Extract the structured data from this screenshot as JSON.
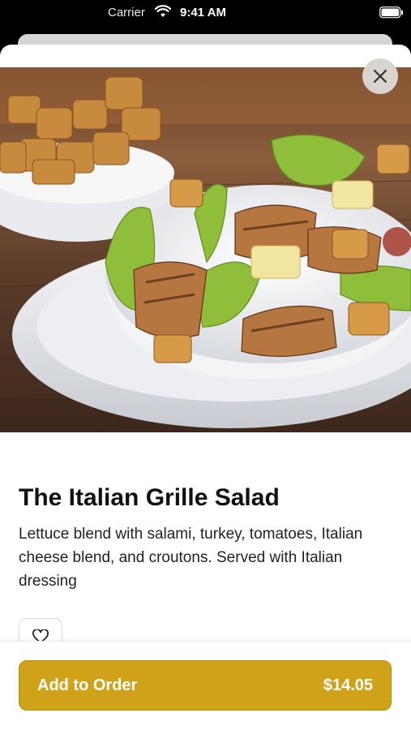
{
  "status_bar": {
    "carrier": "Carrier",
    "time": "9:41 AM"
  },
  "item": {
    "name": "The Italian Grille Salad",
    "description": "Lettuce blend with salami, turkey, tomatoes, Italian cheese blend, and croutons. Served with Italian dressing"
  },
  "actions": {
    "add_label": "Add to Order",
    "price": "$14.05"
  },
  "icons": {
    "close": "close-icon",
    "favorite": "heart-icon",
    "wifi": "wifi-icon",
    "battery": "battery-icon"
  },
  "colors": {
    "accent": "#d0a21a",
    "background": "#ffffff",
    "status_bar": "#000000"
  }
}
